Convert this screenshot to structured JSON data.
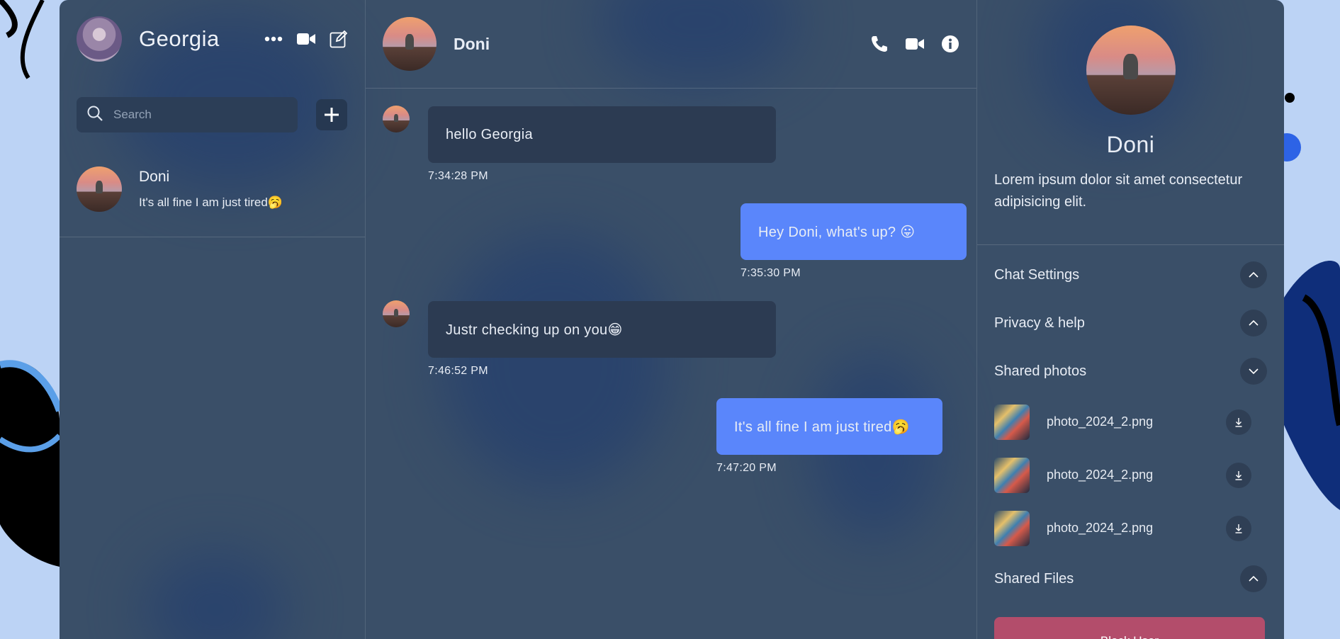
{
  "colors": {
    "accent": "#5a86fb",
    "incoming_bubble": "#2c3b52",
    "panel": "#3a4f68",
    "danger": "#b34d6b"
  },
  "sidebar": {
    "user_name": "Georgia",
    "search_placeholder": "Search",
    "icons": [
      "more-icon",
      "video-icon",
      "compose-icon"
    ],
    "conversations": [
      {
        "name": "Doni",
        "last_message": "It's all fine I am just tired🥱"
      }
    ]
  },
  "chat": {
    "contact_name": "Doni",
    "icons": [
      "phone-icon",
      "video-icon",
      "info-icon"
    ],
    "messages": [
      {
        "direction": "in",
        "text": "hello Georgia",
        "time": "7:34:28 PM"
      },
      {
        "direction": "out",
        "text": "Hey Doni, what's up? 😛",
        "time": "7:35:30 PM"
      },
      {
        "direction": "in",
        "text": "Justr checking up on you😁",
        "time": "7:46:52 PM"
      },
      {
        "direction": "out",
        "text": "It's all fine I am just tired🥱",
        "time": "7:47:20 PM"
      }
    ]
  },
  "details": {
    "name": "Doni",
    "bio": "Lorem ipsum dolor sit amet consectetur adipisicing elit.",
    "sections": {
      "chat_settings": "Chat Settings",
      "privacy": "Privacy & help",
      "shared_photos": "Shared photos",
      "shared_files": "Shared Files"
    },
    "photos": [
      "photo_2024_2.png",
      "photo_2024_2.png",
      "photo_2024_2.png"
    ],
    "block_label": "Block User"
  }
}
